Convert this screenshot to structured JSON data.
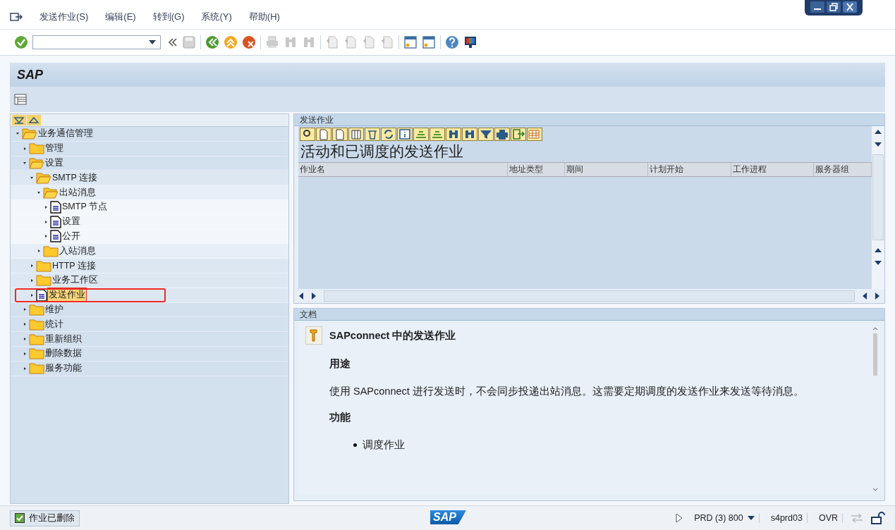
{
  "menu": [
    "发送作业(S)",
    "编辑(E)",
    "转到(G)",
    "系统(Y)",
    "帮助(H)"
  ],
  "title": "SAP",
  "tree": [
    {
      "label": "业务通信管理",
      "kind": "folder",
      "expanded": true,
      "selected": false,
      "children": [
        {
          "label": "管理",
          "kind": "folder",
          "expanded": false,
          "selected": false
        },
        {
          "label": "设置",
          "kind": "folder",
          "expanded": true,
          "selected": false,
          "children": [
            {
              "label": "SMTP 连接",
              "kind": "folder",
              "expanded": true,
              "selected": false,
              "children": [
                {
                  "label": "出站消息",
                  "kind": "folder",
                  "expanded": true,
                  "selected": false,
                  "children": [
                    {
                      "label": "SMTP 节点",
                      "kind": "document",
                      "selected": false
                    },
                    {
                      "label": "设置",
                      "kind": "document",
                      "selected": false
                    },
                    {
                      "label": "公开",
                      "kind": "document",
                      "selected": false
                    }
                  ]
                },
                {
                  "label": "入站消息",
                  "kind": "folder",
                  "expanded": false,
                  "selected": false
                }
              ]
            },
            {
              "label": "HTTP 连接",
              "kind": "folder",
              "expanded": false,
              "selected": false
            },
            {
              "label": "业务工作区",
              "kind": "folder",
              "expanded": false,
              "selected": false
            },
            {
              "label": "发送作业",
              "kind": "document",
              "selected": true
            }
          ]
        },
        {
          "label": "维护",
          "kind": "folder",
          "expanded": false,
          "selected": false
        },
        {
          "label": "统计",
          "kind": "folder",
          "expanded": false,
          "selected": false
        },
        {
          "label": "重新组织",
          "kind": "folder",
          "expanded": false,
          "selected": false
        },
        {
          "label": "删除数据",
          "kind": "folder",
          "expanded": false,
          "selected": false
        },
        {
          "label": "服务功能",
          "kind": "folder",
          "expanded": false,
          "selected": false
        }
      ]
    }
  ],
  "job_panel": {
    "header": "发送作业",
    "title": "活动和已调度的发送作业",
    "columns": [
      "作业名",
      "地址类型",
      "期间",
      "计划开始",
      "工作进程",
      "服务器组"
    ]
  },
  "doc_panel": {
    "header": "文档",
    "heading": "SAPconnect 中的发送作业",
    "sections": [
      {
        "heading": "用途",
        "text": "使用 SAPconnect 进行发送时，不会同步投递出站消息。这需要定期调度的发送作业来发送等待消息。"
      },
      {
        "heading": "功能",
        "bullets": [
          "调度作业"
        ]
      }
    ]
  },
  "status_bar": {
    "message": "作业已删除",
    "logo": "SAP",
    "system": "PRD (3) 800",
    "server": "s4prd03",
    "mode": "OVR"
  }
}
